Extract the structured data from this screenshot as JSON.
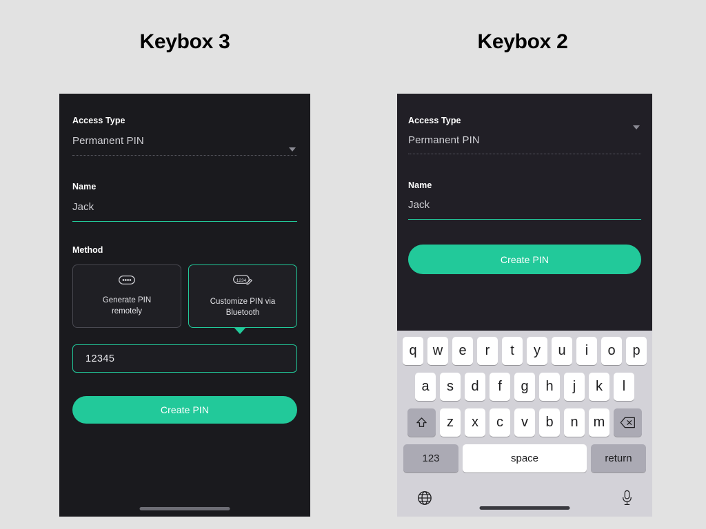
{
  "theme": {
    "page_background": "#e2e2e2",
    "panel_background": "#1a1a1e",
    "panel_background_alt": "#211f26",
    "accent": "#22c99a",
    "text_primary": "#ffffff",
    "text_secondary": "#cfcfd4",
    "keyboard_background": "#d3d2d8",
    "key_background": "#ffffff",
    "key_function_background": "#abaab4"
  },
  "panels": {
    "left": {
      "title": "Keybox 3",
      "access_type": {
        "label": "Access Type",
        "value": "Permanent PIN",
        "dropdown_icon": "chevron-down-icon"
      },
      "name": {
        "label": "Name",
        "value": "Jack",
        "placeholder": "Name"
      },
      "method": {
        "label": "Method",
        "options": [
          {
            "title_line1": "Generate PIN",
            "title_line2": "remotely",
            "icon": "pin-dots-icon",
            "selected": false
          },
          {
            "title_line1": "Customize PIN via",
            "title_line2": "Bluetooth",
            "icon": "pin-edit-icon",
            "selected": true
          }
        ]
      },
      "pin_input": {
        "value": "12345",
        "placeholder": "PIN"
      },
      "submit_button": {
        "label": "Create PIN"
      }
    },
    "right": {
      "title": "Keybox 2",
      "access_type": {
        "label": "Access Type",
        "value": "Permanent PIN",
        "dropdown_icon": "chevron-down-icon"
      },
      "name": {
        "label": "Name",
        "value": "Jack",
        "placeholder": "Name"
      },
      "submit_button": {
        "label": "Create PIN"
      },
      "keyboard": {
        "rows": [
          [
            "q",
            "w",
            "e",
            "r",
            "t",
            "y",
            "u",
            "i",
            "o",
            "p"
          ],
          [
            "a",
            "s",
            "d",
            "f",
            "g",
            "h",
            "j",
            "k",
            "l"
          ],
          [
            "z",
            "x",
            "c",
            "v",
            "b",
            "n",
            "m"
          ]
        ],
        "shift_key": "shift-icon",
        "backspace_key": "backspace-icon",
        "numeric_key": "123",
        "space_key": "space",
        "return_key": "return",
        "globe_key": "globe-icon",
        "mic_key": "microphone-icon"
      }
    }
  }
}
